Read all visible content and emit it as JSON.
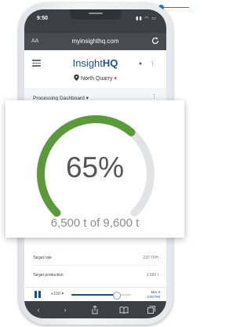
{
  "status_bar": {
    "time": "9:50"
  },
  "browser": {
    "text_size_label": "AA",
    "url": "myinsighthq.com"
  },
  "app_header": {
    "brand_part1": "Insight",
    "brand_part2": "HQ",
    "location": "North Quarry",
    "location_arrow": "▾"
  },
  "dashboard": {
    "label": "Processing Dashboard",
    "dropdown_arrow": "▾"
  },
  "gauge": {
    "percent_text": "65%",
    "fraction": 0.65,
    "subtitle": "6,500 t of 9,600 t",
    "fill_color": "#5b9a3a",
    "track_color": "#e2e3e5"
  },
  "table": {
    "rows": [
      {
        "label": "Target rate",
        "value": "220 TPH"
      },
      {
        "label": "Target production",
        "value": "1,565 t"
      }
    ]
  },
  "playback": {
    "speed": "x100",
    "speed_arrow": "▾",
    "progress": 0.75,
    "date_line1": "Mar 8",
    "date_line2": "3:00 PM"
  },
  "colors": {
    "brand": "#1b4f8c",
    "callout": "#2b7bbd"
  }
}
